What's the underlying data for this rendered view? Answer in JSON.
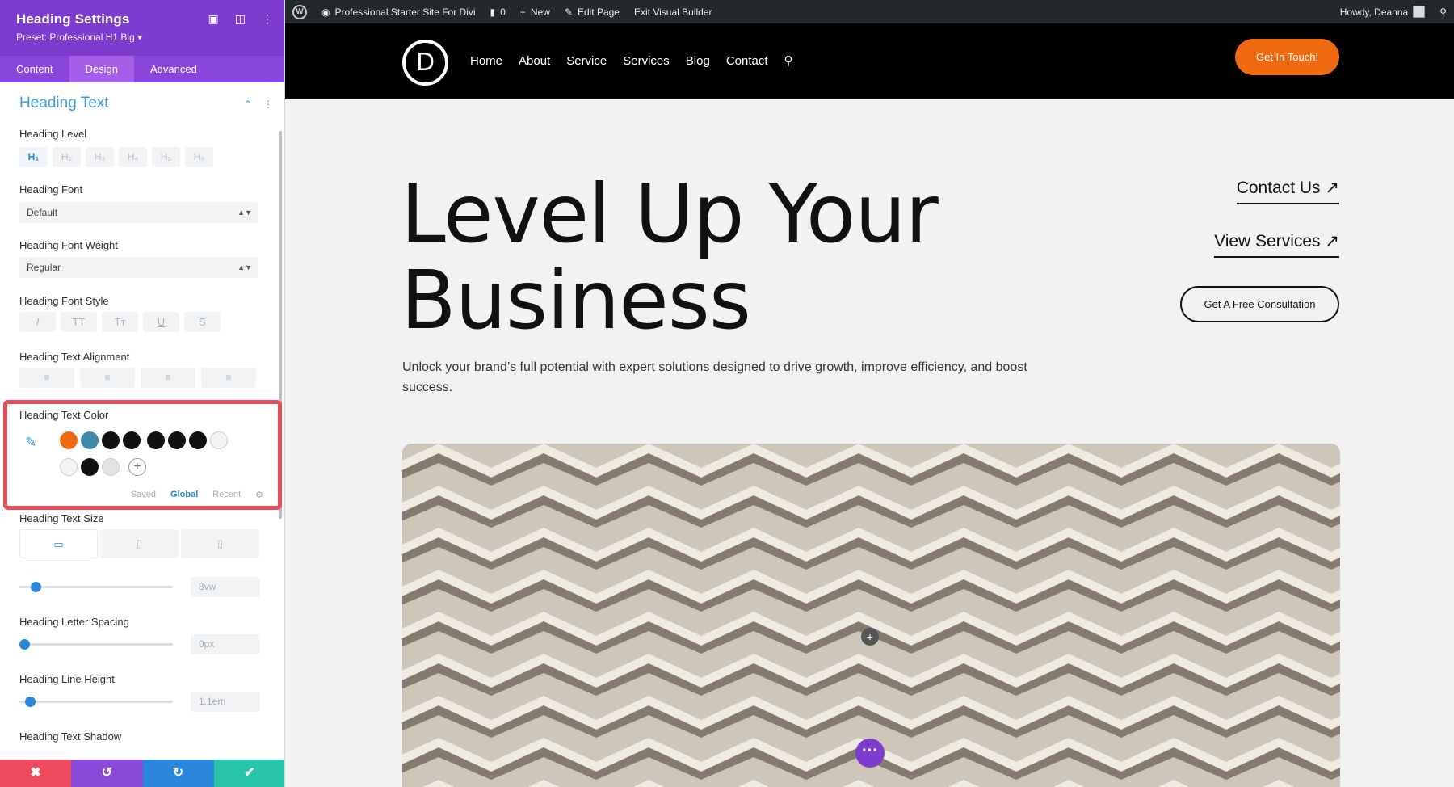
{
  "panel": {
    "title": "Heading Settings",
    "preset": "Preset: Professional H1 Big ▾",
    "tabs": [
      "Content",
      "Design",
      "Advanced"
    ],
    "section_title": "Heading Text",
    "heading_level_label": "Heading Level",
    "heading_levels": [
      "H₁",
      "H₂",
      "H₃",
      "H₄",
      "H₅",
      "H₆"
    ],
    "heading_font_label": "Heading Font",
    "heading_font_value": "Default",
    "heading_font_weight_label": "Heading Font Weight",
    "heading_font_weight_value": "Regular",
    "heading_font_style_label": "Heading Font Style",
    "font_styles": [
      "I",
      "TT",
      "Tᴛ",
      "U",
      "S"
    ],
    "heading_text_alignment_label": "Heading Text Alignment",
    "heading_text_color_label": "Heading Text Color",
    "color_tabs": [
      "Saved",
      "Global",
      "Recent"
    ],
    "heading_text_size_label": "Heading Text Size",
    "heading_text_size_value": "8vw",
    "heading_text_size_level": 0.08,
    "heading_letter_spacing_label": "Heading Letter Spacing",
    "heading_letter_spacing_value": "0px",
    "heading_letter_spacing_level": 0.0,
    "heading_line_height_label": "Heading Line Height",
    "heading_line_height_value": "1.1em",
    "heading_line_height_level": 0.04,
    "heading_text_shadow_label": "Heading Text Shadow"
  },
  "swatch_colors": {
    "row1": [
      "#f06a11",
      "#3f8aa8",
      "#111111",
      "#111111",
      "#111111",
      "#111111",
      "#111111",
      "#f4f4f4"
    ],
    "row2": [
      "#f4f4f4",
      "#111111",
      "#e3e3e3"
    ]
  },
  "colors": {
    "accent_purple": "#7e3bd0",
    "accent_blue": "#2b87da",
    "highlight_red": "#e74c5a",
    "cta_orange": "#f06a11",
    "bottom_bar": [
      "#ee4b5c",
      "#8d49da",
      "#2b87da",
      "#29c4a9"
    ]
  },
  "adminbar": {
    "site_name": "Professional Starter Site For Divi",
    "comments_count": "0",
    "new_label": "New",
    "edit_page_label": "Edit Page",
    "exit_builder_label": "Exit Visual Builder",
    "greeting": "Howdy, Deanna"
  },
  "site": {
    "logo_letter": "D",
    "nav": [
      "Home",
      "About",
      "Service",
      "Services",
      "Blog",
      "Contact"
    ],
    "cta_label": "Get In Touch!",
    "hero_title_line1": "Level Up Your",
    "hero_title_line2": "Business",
    "hero_text": "Unlock your brand’s full potential with expert solutions designed to drive growth, improve efficiency, and boost success.",
    "link_contact": "Contact Us ↗",
    "link_services": "View Services ↗",
    "consultation_label": "Get A Free Consultation"
  }
}
